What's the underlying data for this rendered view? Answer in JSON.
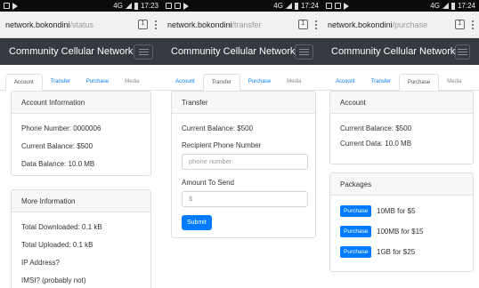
{
  "panels": [
    {
      "status": {
        "network": "4G",
        "time": "17:23"
      },
      "url": {
        "host": "network.bokondini",
        "path": "/status"
      },
      "tab_count": "1",
      "brand": "Community Cellular Network",
      "tabs": [
        "Account",
        "Transfer",
        "Purchase",
        "Media"
      ],
      "active_tab": 0,
      "cards": [
        {
          "title": "Account Information",
          "rows": [
            "Phone Number: 0000006",
            "Current Balance: $500",
            "Data Balance: 10.0 MB"
          ]
        },
        {
          "title": "More Information",
          "rows": [
            "Total Downloaded: 0.1 kB",
            "Total Uploaded: 0.1 kB",
            "IP Address?",
            "IMSI? (probably not)"
          ]
        }
      ]
    },
    {
      "status": {
        "network": "4G",
        "time": "17:24"
      },
      "url": {
        "host": "network.bokondini",
        "path": "/transfer"
      },
      "tab_count": "1",
      "brand": "Community Cellular Network",
      "tabs": [
        "Account",
        "Transfer",
        "Purchase",
        "Media"
      ],
      "active_tab": 1,
      "transfer": {
        "title": "Transfer",
        "balance": "Current Balance: $500",
        "recipient_label": "Recipient Phone Number",
        "recipient_placeholder": "phone number",
        "amount_label": "Amount To Send",
        "amount_placeholder": "$",
        "submit": "Submit"
      }
    },
    {
      "status": {
        "network": "4G",
        "time": "17:24"
      },
      "url": {
        "host": "network.bokondini",
        "path": "/purchase"
      },
      "tab_count": "1",
      "brand": "Community Cellular Network",
      "tabs": [
        "Account",
        "Transfer",
        "Purchase",
        "Media"
      ],
      "active_tab": 2,
      "account": {
        "title": "Account",
        "rows": [
          "Current Balance: $500",
          "Current Data: 10.0 MB"
        ]
      },
      "packages": {
        "title": "Packages",
        "items": [
          {
            "button": "Purchase",
            "label": "10MB for $5"
          },
          {
            "button": "Purchase",
            "label": "100MB for $15"
          },
          {
            "button": "Purchase",
            "label": "1GB for $25"
          }
        ]
      }
    }
  ],
  "colors": {
    "navbar": "#343a40",
    "primary": "#007bff",
    "link": "#007bff"
  }
}
